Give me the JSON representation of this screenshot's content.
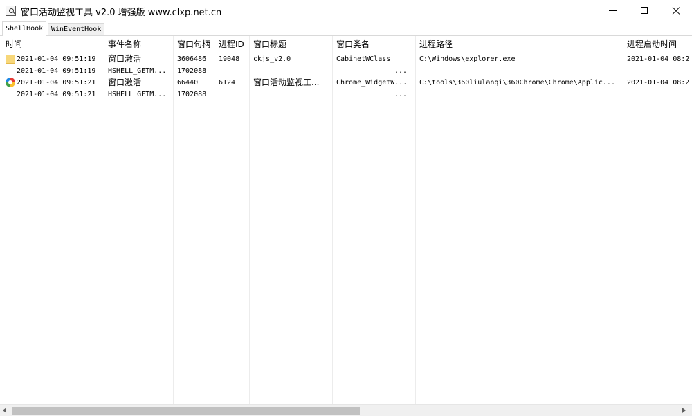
{
  "window": {
    "title": "窗口活动监视工具 v2.0 增强版 www.clxp.net.cn"
  },
  "tabs": [
    {
      "label": "ShellHook",
      "active": true
    },
    {
      "label": "WinEventHook",
      "active": false
    }
  ],
  "columns": [
    "时间",
    "事件名称",
    "窗口句柄",
    "进程ID",
    "窗口标题",
    "窗口类名",
    "进程路径",
    "进程启动时间"
  ],
  "rows": [
    {
      "icon": "folder-icon",
      "time": "2021-01-04 09:51:19",
      "event": "窗口激活",
      "hwnd": "3606486",
      "pid": "19048",
      "title": "ckjs_v2.0",
      "class": "CabinetWClass",
      "path": "C:\\Windows\\explorer.exe",
      "start": "2021-01-04 08:2"
    },
    {
      "icon": "",
      "time": "2021-01-04 09:51:19",
      "event": "HSHELL_GETM...",
      "hwnd": "1702088",
      "pid": "",
      "title": "",
      "class": "",
      "path": "",
      "start": ""
    },
    {
      "icon": "chrome-icon",
      "time": "2021-01-04 09:51:21",
      "event": "窗口激活",
      "hwnd": "66440",
      "pid": "6124",
      "title": "窗口活动监视工...",
      "class": "Chrome_WidgetW...",
      "path": "C:\\tools\\360liulanqi\\360Chrome\\Chrome\\Applic...",
      "start": "2021-01-04 08:2"
    },
    {
      "icon": "",
      "time": "2021-01-04 09:51:21",
      "event": "HSHELL_GETM...",
      "hwnd": "1702088",
      "pid": "",
      "title": "",
      "class": "",
      "path": "",
      "start": ""
    }
  ],
  "overflow_marks": [
    "...",
    "..."
  ],
  "scrollbar": {
    "position": 0.0,
    "visible_fraction": 0.52
  }
}
